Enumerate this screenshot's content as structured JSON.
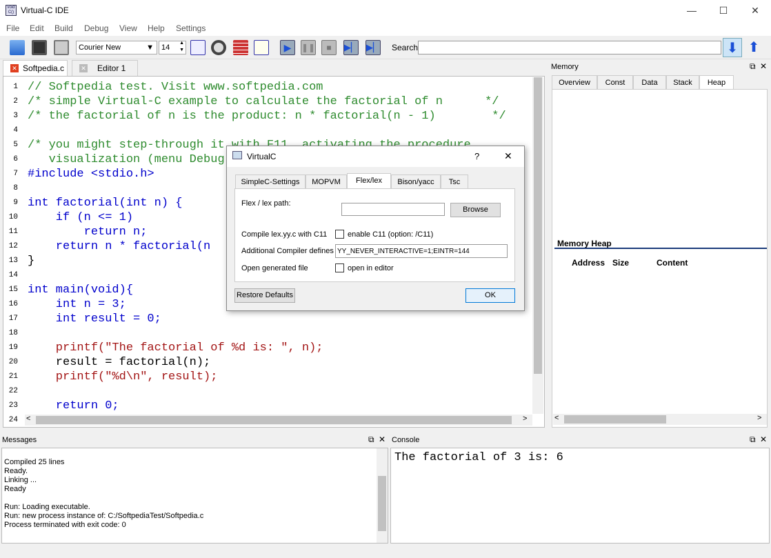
{
  "window": {
    "title": "Virtual-C IDE",
    "minimize": "—",
    "maximize": "☐",
    "close": "✕"
  },
  "menu": [
    "File",
    "Edit",
    "Build",
    "Debug",
    "View",
    "Help",
    "Settings"
  ],
  "toolbar": {
    "font": "Courier New",
    "size": "14",
    "search_label": "Search:",
    "search_value": ""
  },
  "editor_tabs": [
    {
      "label": "Softpedia.c"
    },
    {
      "label": "Editor 1"
    }
  ],
  "code": {
    "line_numbers": [
      "1",
      "2",
      "3",
      "4",
      "5",
      "6",
      "7",
      "8",
      "9",
      "10",
      "11",
      "12",
      "13",
      "14",
      "15",
      "16",
      "17",
      "18",
      "19",
      "20",
      "21",
      "22",
      "23",
      "24"
    ],
    "lines": [
      "// Softpedia test. Visit www.softpedia.com",
      "/* simple Virtual-C example to calculate the factorial of n      */",
      "/* the factorial of n is the product: n * factorial(n - 1)        */",
      "",
      "/* you might step-through it with F11, activating the procedure",
      "   visualization (menu Debug",
      "#include <stdio.h>",
      "",
      "int factorial(int n) {",
      "    if (n <= 1)",
      "        return n;",
      "    return n * factorial(n",
      "}",
      "",
      "int main(void){",
      "    int n = 3;",
      "    int result = 0;",
      "",
      "    printf(\"The factorial of %d is: \", n);",
      "    result = factorial(n);",
      "    printf(\"%d\\n\", result);",
      "",
      "    return 0;",
      ""
    ]
  },
  "memory": {
    "title": "Memory",
    "tabs": [
      "Overview",
      "Const",
      "Data",
      "Stack",
      "Heap"
    ],
    "heap_title": "Memory Heap",
    "columns": [
      "Address",
      "Size",
      "Content"
    ]
  },
  "messages": {
    "title": "Messages",
    "lines": [
      "Compiled 25 lines",
      "Ready.",
      "Linking ...",
      "Ready",
      "",
      "Run: Loading executable.",
      "Run: new process instance of: C:/SoftpediaTest/Softpedia.c",
      "Process terminated with exit code: 0"
    ]
  },
  "console": {
    "title": "Console",
    "output": "The factorial of 3 is: 6"
  },
  "dialog": {
    "title": "VirtualC",
    "help": "?",
    "close": "✕",
    "tabs": [
      "SimpleC-Settings",
      "MOPVM",
      "Flex/lex",
      "Bison/yacc",
      "Tsc"
    ],
    "flex_path_label": "Flex / lex path:",
    "flex_path_value": "",
    "browse": "Browse",
    "compile_label": "Compile lex.yy.c with C11",
    "enable_c11": "enable C11 (option: /C11)",
    "defines_label": "Additional Compiler defines",
    "defines_value": "YY_NEVER_INTERACTIVE=1;EINTR=144",
    "open_label": "Open generated file",
    "open_editor": "open in editor",
    "restore": "Restore Defaults",
    "ok": "OK"
  }
}
